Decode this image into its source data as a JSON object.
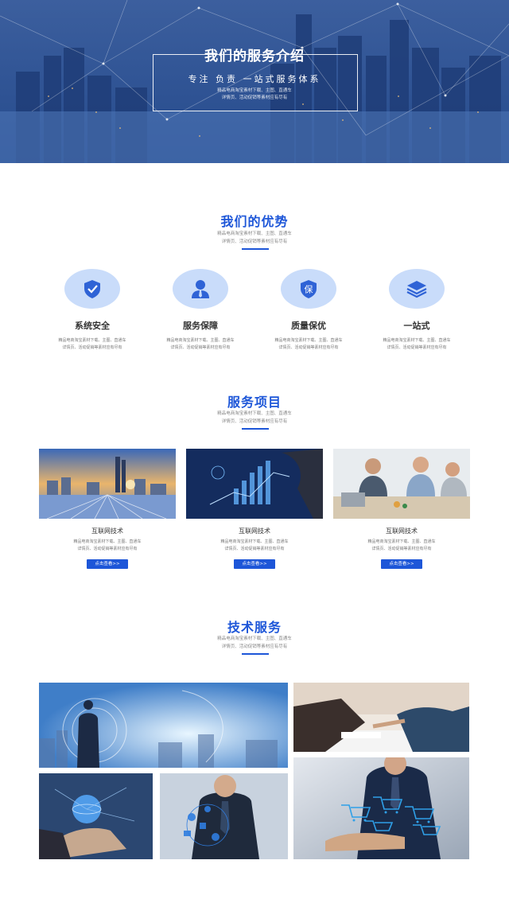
{
  "hero": {
    "title": "我们的服务介绍",
    "subtitle": "专注 负责 一站式服务体系",
    "desc_line1": "精品电商淘宝素材下载、主图、直通车",
    "desc_line2": "详情页、活动促销等素材应有尽有"
  },
  "advantages": {
    "title": "我们的优势",
    "desc_line1": "精品电商淘宝素材下载、主图、直通车",
    "desc_line2": "详情页、活动促销等素材应有尽有",
    "items": [
      {
        "name": "系统安全",
        "icon": "shield-check-icon",
        "desc1": "精品电商淘宝素材下载、主图、直通车",
        "desc2": "详情页、活动促销等素材应有尽有"
      },
      {
        "name": "服务保障",
        "icon": "person-tie-icon",
        "desc1": "精品电商淘宝素材下载、主图、直通车",
        "desc2": "详情页、活动促销等素材应有尽有"
      },
      {
        "name": "质量保优",
        "icon": "bao-shield-icon",
        "badge": "保",
        "desc1": "精品电商淘宝素材下载、主图、直通车",
        "desc2": "详情页、活动促销等素材应有尽有"
      },
      {
        "name": "一站式",
        "icon": "layers-icon",
        "desc1": "精品电商淘宝素材下载、主图、直通车",
        "desc2": "详情页、活动促销等素材应有尽有"
      }
    ]
  },
  "projects": {
    "title": "服务项目",
    "desc_line1": "精品电商淘宝素材下载、主图、直通车",
    "desc_line2": "详情页、活动促销等素材应有尽有",
    "items": [
      {
        "name": "互联网技术",
        "desc1": "精品电商淘宝素材下载、主图、直通车",
        "desc2": "详情页、活动促销等素材应有尽有",
        "button": "点击查看>>"
      },
      {
        "name": "互联网技术",
        "desc1": "精品电商淘宝素材下载、主图、直通车",
        "desc2": "详情页、活动促销等素材应有尽有",
        "button": "点击查看>>"
      },
      {
        "name": "互联网技术",
        "desc1": "精品电商淘宝素材下载、主图、直通车",
        "desc2": "详情页、活动促销等素材应有尽有",
        "button": "点击查看>>"
      }
    ]
  },
  "tech": {
    "title": "技术服务",
    "desc_line1": "精品电商淘宝素材下载、主图、直通车",
    "desc_line2": "详情页、活动促销等素材应有尽有"
  },
  "colors": {
    "accent": "#1d56d8",
    "icon_bg": "#c9dcfa"
  }
}
